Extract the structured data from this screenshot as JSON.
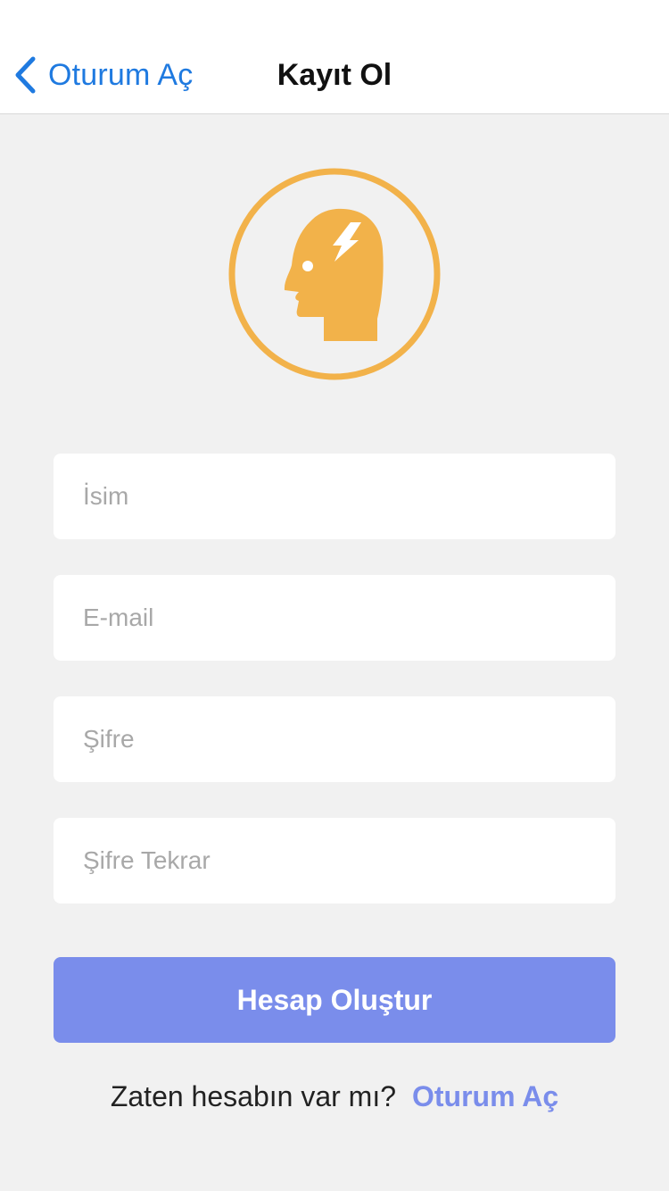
{
  "navbar": {
    "back_label": "Oturum Aç",
    "title": "Kayıt Ol",
    "back_icon": "chevron-left-icon"
  },
  "logo": {
    "icon": "head-lightning-icon",
    "color": "#f2b24a"
  },
  "form": {
    "name_placeholder": "İsim",
    "email_placeholder": "E-mail",
    "password_placeholder": "Şifre",
    "password_repeat_placeholder": "Şifre Tekrar",
    "submit_label": "Hesap Oluştur"
  },
  "footer": {
    "prompt": "Zaten hesabın var mı?",
    "link_label": "Oturum Aç"
  },
  "colors": {
    "nav_accent": "#1f7ae0",
    "button": "#7a8deb",
    "background": "#f1f1f1"
  }
}
